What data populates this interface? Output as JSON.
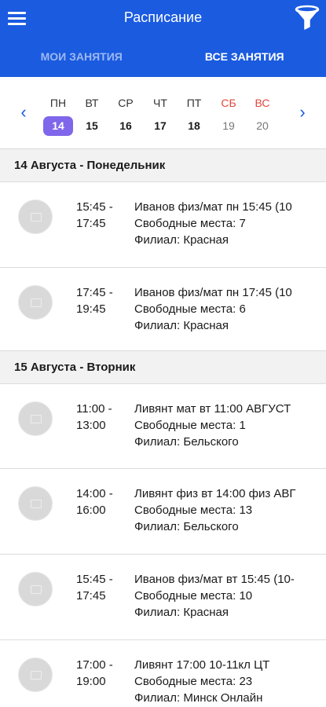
{
  "appbar": {
    "title": "Расписание",
    "menu_icon": "hamburger-menu-icon",
    "filter_icon": "filter-funnel-icon",
    "color": "#1a5be0"
  },
  "tabs": [
    {
      "label": "МОИ ЗАНЯТИЯ",
      "active": false
    },
    {
      "label": "ВСЕ ЗАНЯТИЯ",
      "active": true
    }
  ],
  "calendar": {
    "prev_icon": "chevron-left-icon",
    "next_icon": "chevron-right-icon",
    "days": [
      {
        "name": "ПН",
        "num": "14",
        "selected": true,
        "weekend": false
      },
      {
        "name": "ВТ",
        "num": "15",
        "selected": false,
        "weekend": false
      },
      {
        "name": "СР",
        "num": "16",
        "selected": false,
        "weekend": false
      },
      {
        "name": "ЧТ",
        "num": "17",
        "selected": false,
        "weekend": false
      },
      {
        "name": "ПТ",
        "num": "18",
        "selected": false,
        "weekend": false
      },
      {
        "name": "СБ",
        "num": "19",
        "selected": false,
        "weekend": true
      },
      {
        "name": "ВС",
        "num": "20",
        "selected": false,
        "weekend": true
      }
    ],
    "selected_color": "#7f66ea",
    "weekend_color": "#e0473c"
  },
  "sections": [
    {
      "title": "14 Августа - Понедельник",
      "lessons": [
        {
          "start": "15:45 -",
          "end": "17:45",
          "title": "Иванов физ/мат пн 15:45 (10",
          "seats": "Свободные места: 7",
          "branch": "Филиал: Красная"
        },
        {
          "start": "17:45 -",
          "end": "19:45",
          "title": "Иванов физ/мат пн 17:45 (10",
          "seats": "Свободные места: 6",
          "branch": "Филиал: Красная"
        }
      ]
    },
    {
      "title": "15 Августа - Вторник",
      "lessons": [
        {
          "start": "11:00 -",
          "end": "13:00",
          "title": "Ливянт мат вт 11:00 АВГУСТ",
          "seats": "Свободные места: 1",
          "branch": "Филиал: Бельского"
        },
        {
          "start": "14:00 -",
          "end": "16:00",
          "title": "Ливянт физ вт 14:00 физ АВГ",
          "seats": "Свободные места: 13",
          "branch": "Филиал: Бельского"
        },
        {
          "start": "15:45 -",
          "end": "17:45",
          "title": "Иванов физ/мат вт 15:45 (10-",
          "seats": "Свободные места: 10",
          "branch": "Филиал: Красная"
        },
        {
          "start": "17:00 -",
          "end": "19:00",
          "title": "Ливянт 17:00 10-11кл ЦТ",
          "seats": "Свободные места: 23",
          "branch": "Филиал: Минск Онлайн"
        }
      ]
    }
  ]
}
